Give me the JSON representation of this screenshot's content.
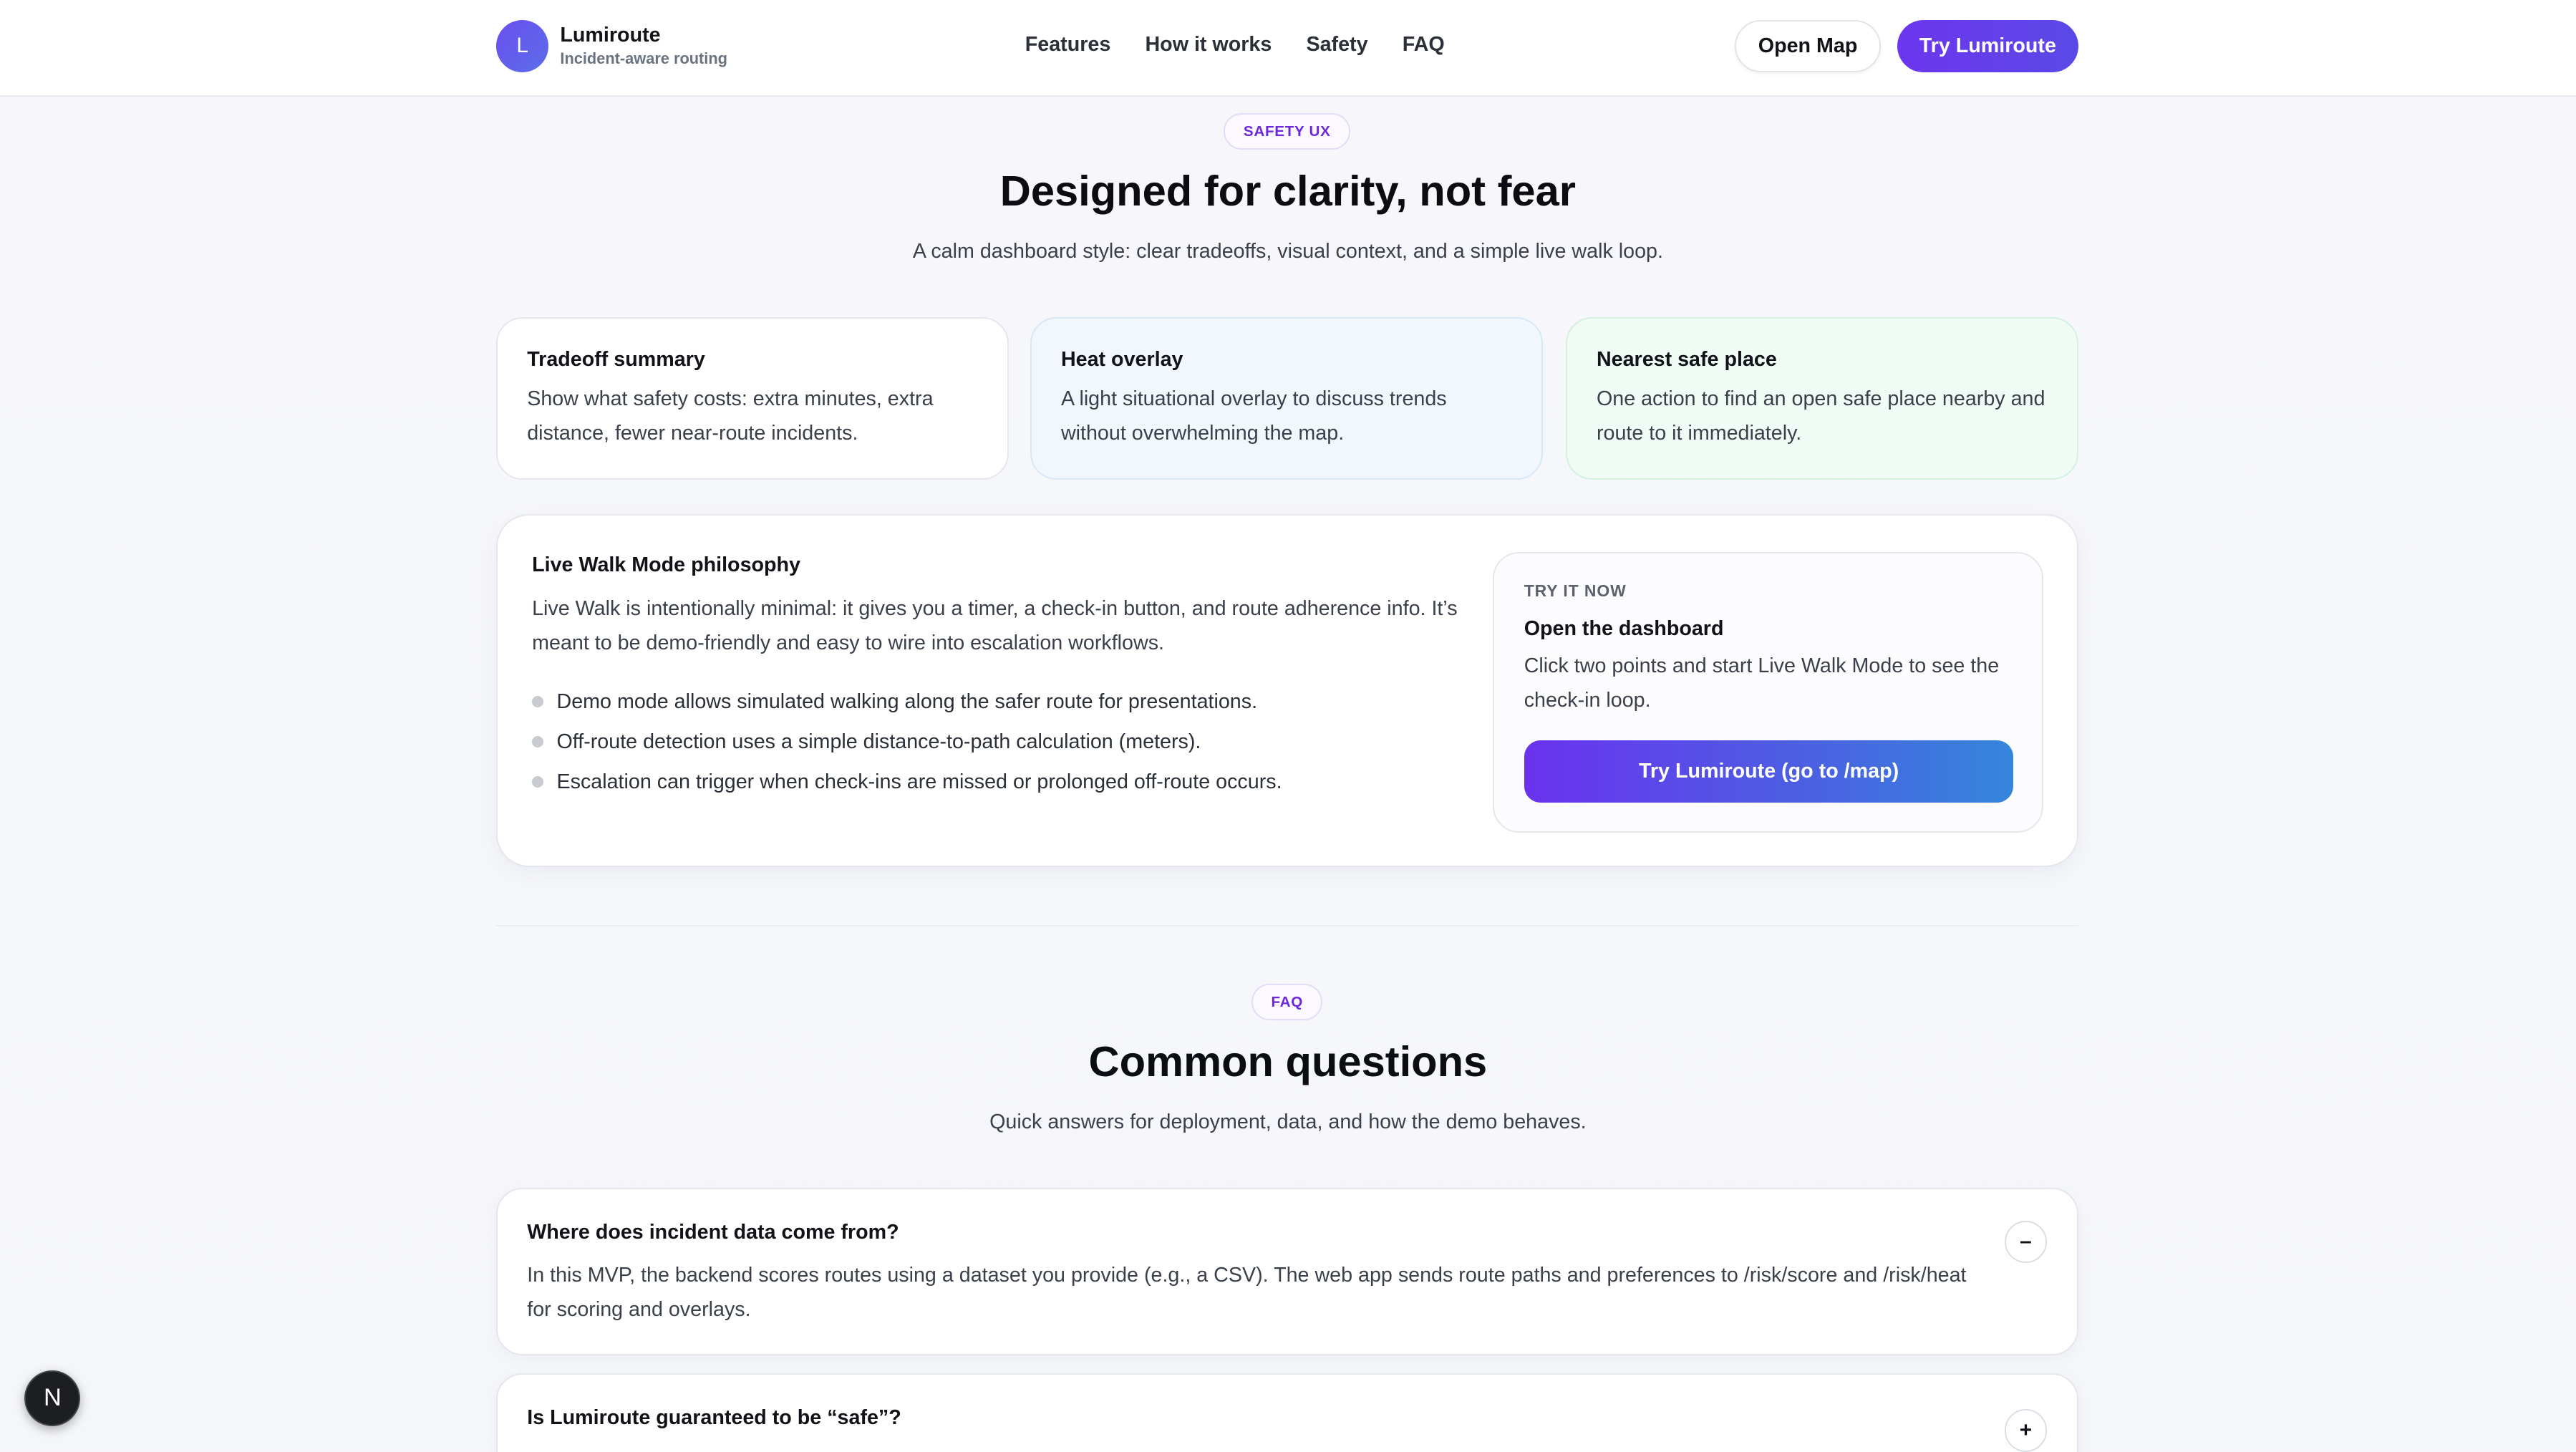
{
  "header": {
    "logo_letter": "L",
    "brand_name": "Lumiroute",
    "brand_tagline": "Incident-aware routing",
    "nav": [
      "Features",
      "How it works",
      "Safety",
      "FAQ"
    ],
    "open_map_label": "Open Map",
    "try_label": "Try Lumiroute"
  },
  "safety": {
    "pill": "SAFETY UX",
    "title": "Designed for clarity, not fear",
    "subtitle": "A calm dashboard style: clear tradeoffs, visual context, and a simple live walk loop.",
    "cards": [
      {
        "title": "Tradeoff summary",
        "text": "Show what safety costs: extra minutes, extra distance, fewer near-route incidents."
      },
      {
        "title": "Heat overlay",
        "text": "A light situational overlay to discuss trends without overwhelming the map."
      },
      {
        "title": "Nearest safe place",
        "text": "One action to find an open safe place nearby and route to it immediately."
      }
    ],
    "live_walk": {
      "title": "Live Walk Mode philosophy",
      "text": "Live Walk is intentionally minimal: it gives you a timer, a check-in button, and route adherence info. It’s meant to be demo-friendly and easy to wire into escalation workflows.",
      "bullets": [
        "Demo mode allows simulated walking along the safer route for presentations.",
        "Off-route detection uses a simple distance-to-path calculation (meters).",
        "Escalation can trigger when check-ins are missed or prolonged off-route occurs."
      ],
      "try": {
        "kicker": "TRY IT NOW",
        "title": "Open the dashboard",
        "text": "Click two points and start Live Walk Mode to see the check-in loop.",
        "button": "Try Lumiroute (go to /map)"
      }
    }
  },
  "faq": {
    "pill": "FAQ",
    "title": "Common questions",
    "subtitle": "Quick answers for deployment, data, and how the demo behaves.",
    "items": [
      {
        "question": "Where does incident data come from?",
        "answer": "In this MVP, the backend scores routes using a dataset you provide (e.g., a CSV). The web app sends route paths and preferences to /risk/score and /risk/heat for scoring and overlays.",
        "toggle": "–"
      },
      {
        "question": "Is Lumiroute guaranteed to be “safe”?",
        "answer": "",
        "toggle": "+"
      }
    ]
  },
  "dev_badge": "N"
}
